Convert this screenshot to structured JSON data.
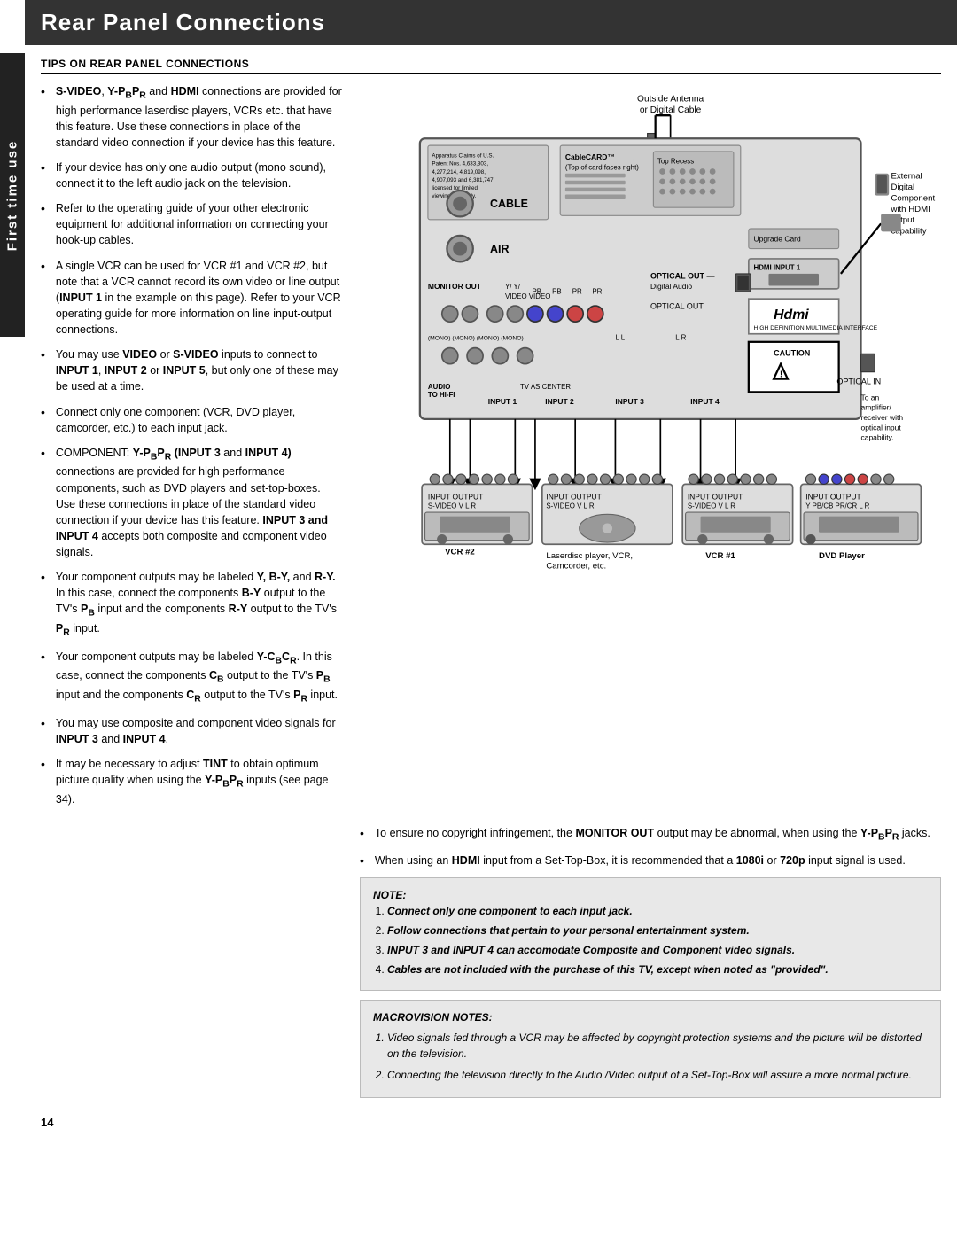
{
  "header": {
    "title": "Rear Panel Connections",
    "side_tab": "First time use"
  },
  "section": {
    "tips_title": "TIPS ON REAR PANEL CONNECTIONS"
  },
  "bullets": [
    {
      "id": 1,
      "text": "S-VIDEO, Y-PBPR and HDMI connections are provided for high performance laserdisc players, VCRs etc. that have this feature. Use these connections in place of the standard video connection if your device has this feature."
    },
    {
      "id": 2,
      "text": "If your device has only one audio output (mono sound), connect it to the left audio jack on the television."
    },
    {
      "id": 3,
      "text": "Refer to the operating guide of your other electronic equipment for additional information on connecting your hook-up cables."
    },
    {
      "id": 4,
      "text": "A single VCR can be used for VCR #1 and VCR #2, but note that a VCR cannot record its own video or line output (INPUT 1 in the example on this page). Refer to your VCR operating guide for more information on line input-output connections."
    },
    {
      "id": 5,
      "text": "You may use VIDEO or S-VIDEO inputs to connect to INPUT 1, INPUT 2 or INPUT 5, but only one of these may be used at a time."
    },
    {
      "id": 6,
      "text": "Connect only one component (VCR, DVD player, camcorder, etc.) to each input jack."
    },
    {
      "id": 7,
      "text": "COMPONENT: Y-PBPR (INPUT 3 and INPUT 4) connections are provided for high performance components, such as DVD players and set-top-boxes. Use these connections in place of the standard video connection if your device has this feature. INPUT 3 and INPUT 4 accepts both composite and component video signals."
    },
    {
      "id": 8,
      "text": "Your component outputs may be labeled Y, B-Y, and R-Y. In this case, connect the components B-Y output to the TV’s PB input and the components R-Y output to the TV’s PR input."
    },
    {
      "id": 9,
      "text": "Your component outputs may be labeled Y-CBCR. In this case, connect the components CB output to the TV’s PB input and the components CR output to the TV’s PR input."
    },
    {
      "id": 10,
      "text": "You may use composite and component video signals for INPUT 3 and INPUT 4."
    },
    {
      "id": 11,
      "text": "It may be necessary to adjust TINT to obtain optimum picture quality when using the Y-PBPR inputs (see page 34)."
    }
  ],
  "right_bullets": [
    {
      "id": 1,
      "text": "To ensure no copyright infringement, the MONITOR OUT output may be abnormal, when using the Y-PBPR jacks."
    },
    {
      "id": 2,
      "text": "When using an HDMI input from a Set-Top-Box, it is recommended that a 1080i or 720p input signal is used."
    }
  ],
  "note": {
    "title": "NOTE:",
    "items": [
      "Connect only one component to each input jack.",
      "Follow connections that pertain to your personal entertainment system.",
      "INPUT 3 and INPUT 4 can accomodate Composite and Component video signals.",
      "Cables are not included with the purchase of this TV, except when noted as “provided”."
    ]
  },
  "macrovision": {
    "title": "MACROVISION NOTES:",
    "items": [
      "Video signals fed through a VCR may be affected by copyright protection systems and the picture will be distorted on the television.",
      "Connecting the television directly to the Audio /Video output of a Set-Top-Box will assure a more normal picture."
    ]
  },
  "diagram": {
    "cable_label": "CABLE",
    "air_label": "AIR",
    "hdmi_label": "HDMI INPUT 1",
    "optical_out_label": "OPTICAL OUT\nDigital Audio",
    "outside_antenna_label": "Outside Antenna\nor Digital Cable",
    "external_digital_label": "External\nDigital\nComponent\nwith HDMI\noutput\ncapability",
    "cablecard_label": "CableCARD™\n(Top of card faces right)",
    "upgrade_card_label": "Upgrade Card",
    "optical_in_label": "To an\namplifier/\nreceiver with\noptical input\ncapability.",
    "caution_label": "CAUTION",
    "devices": [
      {
        "label": "VCR #2",
        "inputs": "INPUT",
        "outputs": "OUTPUT",
        "svideo": "S-VIDEO V  L    R"
      },
      {
        "label": "Laserdisc player, VCR,\nCamcorder, etc.",
        "inputs": "INPUT",
        "outputs": "OUTPUT",
        "svideo": "S-VIDEO V  L    R"
      },
      {
        "label": "VCR #1",
        "inputs": "INPUT",
        "outputs": "OUTPUT",
        "svideo": "S-VIDEO V  L    R"
      },
      {
        "label": "DVD Player",
        "inputs": "INPUT",
        "outputs": "OUTPUT",
        "svideo": "Y  PB/CB PR/CR  L    R"
      }
    ],
    "panel_labels": {
      "monitor_out": "MONITOR OUT",
      "audio_to_hifi": "AUDIO\nTO HI-FI",
      "input1": "INPUT 1",
      "input2": "INPUT 2",
      "input3": "INPUT 3",
      "input4": "INPUT 4",
      "tv_as_center": "TV AS CENTER"
    }
  },
  "page_number": "14"
}
